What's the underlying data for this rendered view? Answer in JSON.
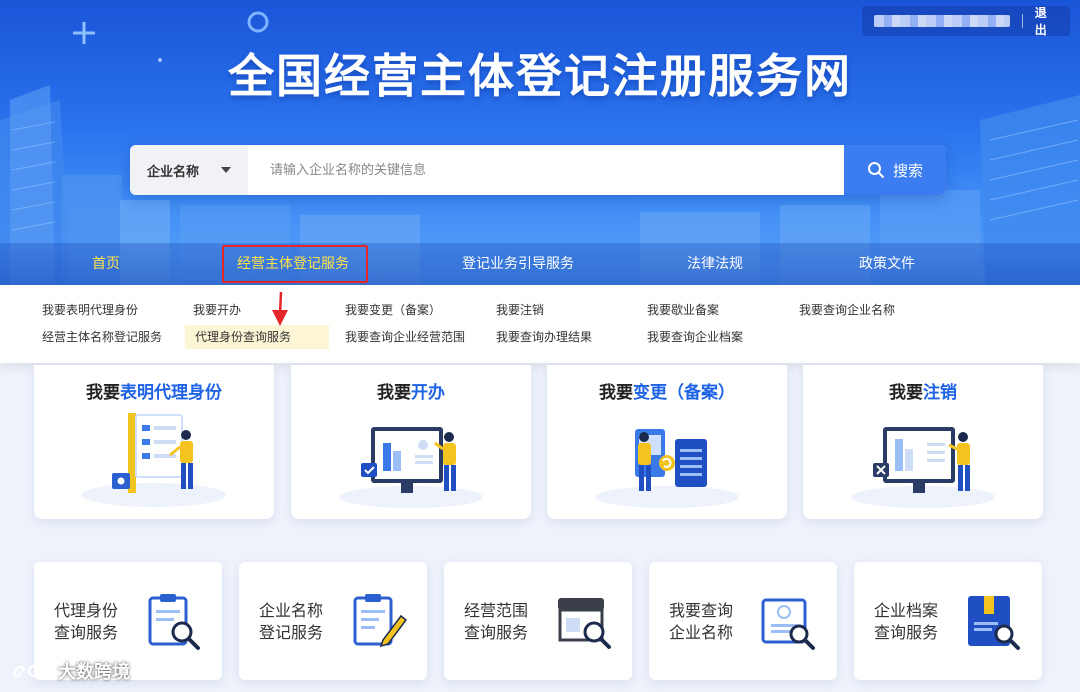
{
  "topbar": {
    "logout": "退出"
  },
  "site_title": "全国经营主体登记注册服务网",
  "search": {
    "type": "企业名称",
    "placeholder": "请输入企业名称的关键信息",
    "button": "搜索"
  },
  "nav": {
    "items": [
      {
        "label": "首页"
      },
      {
        "label": "经营主体登记服务"
      },
      {
        "label": "登记业务引导服务"
      },
      {
        "label": "法律法规"
      },
      {
        "label": "政策文件"
      }
    ]
  },
  "dropdown": {
    "items": [
      {
        "label": "我要表明代理身份"
      },
      {
        "label": "我要开办"
      },
      {
        "label": "我要变更（备案）"
      },
      {
        "label": "我要注销"
      },
      {
        "label": "我要歇业备案"
      },
      {
        "label": "我要查询企业名称"
      },
      {
        "label": "经营主体名称登记服务"
      },
      {
        "label": "代理身份查询服务"
      },
      {
        "label": "我要查询企业经营范围"
      },
      {
        "label": "我要查询办理结果"
      },
      {
        "label": "我要查询企业档案"
      }
    ]
  },
  "big_cards": [
    {
      "prefix": "我要",
      "highlight": "表明代理身份",
      "suffix": ""
    },
    {
      "prefix": "我要",
      "highlight": "开办",
      "suffix": ""
    },
    {
      "prefix": "我要",
      "highlight": "变更（备案）",
      "suffix": ""
    },
    {
      "prefix": "我要",
      "highlight": "注销",
      "suffix": ""
    }
  ],
  "small_cards": [
    {
      "line1": "代理身份",
      "line2": "查询服务"
    },
    {
      "line1": "企业名称",
      "line2": "登记服务"
    },
    {
      "line1": "经营范围",
      "line2": "查询服务"
    },
    {
      "line1": "我要查询",
      "line2": "企业名称"
    },
    {
      "line1": "企业档案",
      "line2": "查询服务"
    }
  ],
  "watermark": "大数跨境",
  "colors": {
    "primary": "#1e63e6",
    "nav_active": "#ffe14a",
    "annotation_red": "#e4262b"
  }
}
